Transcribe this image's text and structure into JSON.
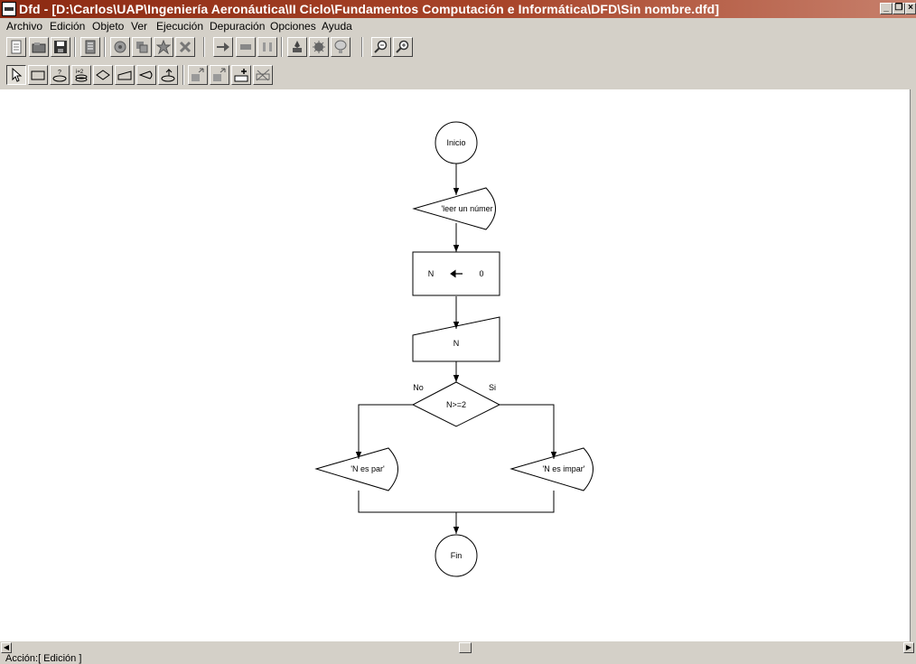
{
  "window": {
    "title": "Dfd - [D:\\Carlos\\UAP\\Ingeniería Aeronáutica\\II Ciclo\\Fundamentos Computación e Informática\\DFD\\Sin nombre.dfd]",
    "buttons": [
      "minimize",
      "restore",
      "close"
    ]
  },
  "menu": [
    "Archivo",
    "Edición",
    "Objeto",
    "Ver",
    "Ejecución",
    "Depuración",
    "Opciones",
    "Ayuda"
  ],
  "toolbar1": [
    {
      "name": "new-icon"
    },
    {
      "name": "open-icon"
    },
    {
      "name": "save-icon"
    },
    {
      "name": "print-icon"
    },
    {
      "name": "cut-icon"
    },
    {
      "name": "copy-icon"
    },
    {
      "name": "paste-icon"
    },
    {
      "name": "delete-icon"
    },
    {
      "name": "run-icon"
    },
    {
      "name": "stop-icon"
    },
    {
      "name": "pause-icon"
    },
    {
      "name": "step-icon"
    },
    {
      "name": "debug-icon"
    },
    {
      "name": "watch-icon"
    },
    {
      "name": "zoom-out-icon"
    },
    {
      "name": "zoom-in-icon"
    }
  ],
  "toolbar2": [
    {
      "name": "pointer-icon",
      "pressed": true
    },
    {
      "name": "assignment-icon"
    },
    {
      "name": "decision-icon"
    },
    {
      "name": "loop-for-icon"
    },
    {
      "name": "loop-while-icon"
    },
    {
      "name": "read-icon"
    },
    {
      "name": "write-icon"
    },
    {
      "name": "call-icon"
    },
    {
      "name": "subprogram-prev-icon"
    },
    {
      "name": "subprogram-next-icon"
    },
    {
      "name": "subprogram-add-icon"
    },
    {
      "name": "subprogram-delete-icon"
    }
  ],
  "flowchart": {
    "start": "Inicio",
    "output_prompt": "'leer un númer",
    "assign_var": "N",
    "assign_value": "0",
    "read_var": "N",
    "condition": "N>=2",
    "branch_no": "No",
    "branch_yes": "Si",
    "output_no": "'N es par'",
    "output_yes": "'N es impar'",
    "end": "Fin"
  },
  "status": "Acción:[ Edición ]"
}
